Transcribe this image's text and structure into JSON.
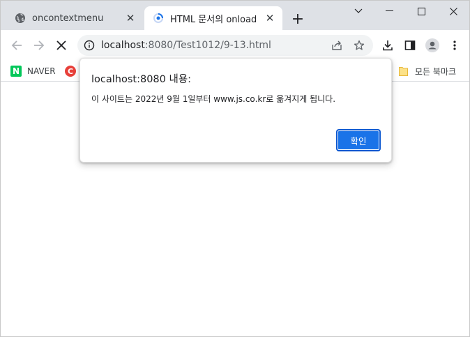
{
  "tabs": [
    {
      "title": "oncontextmenu",
      "active": false
    },
    {
      "title": "HTML 문서의 onload",
      "active": true
    }
  ],
  "window_controls": {
    "dropdown": "chevron-down-icon",
    "minimize": "minimize-icon",
    "maximize": "maximize-icon",
    "close": "close-icon"
  },
  "toolbar": {
    "url_host": "localhost",
    "url_rest": ":8080/Test1012/9-13.html",
    "loading": true
  },
  "bookmarks": {
    "items": [
      {
        "label": "NAVER",
        "icon": "naver-icon"
      },
      {
        "label": "",
        "icon": "c-site-icon"
      }
    ],
    "all_bookmarks": "모든 북마크"
  },
  "dialog": {
    "title": "localhost:8080 내용:",
    "message": "이 사이트는 2022년 9월 1일부터 www.js.co.kr로 옮겨지게 됩니다.",
    "ok_label": "확인"
  },
  "colors": {
    "tabstrip": "#dee1e6",
    "accent": "#1a73e8",
    "naver": "#03c75a"
  }
}
